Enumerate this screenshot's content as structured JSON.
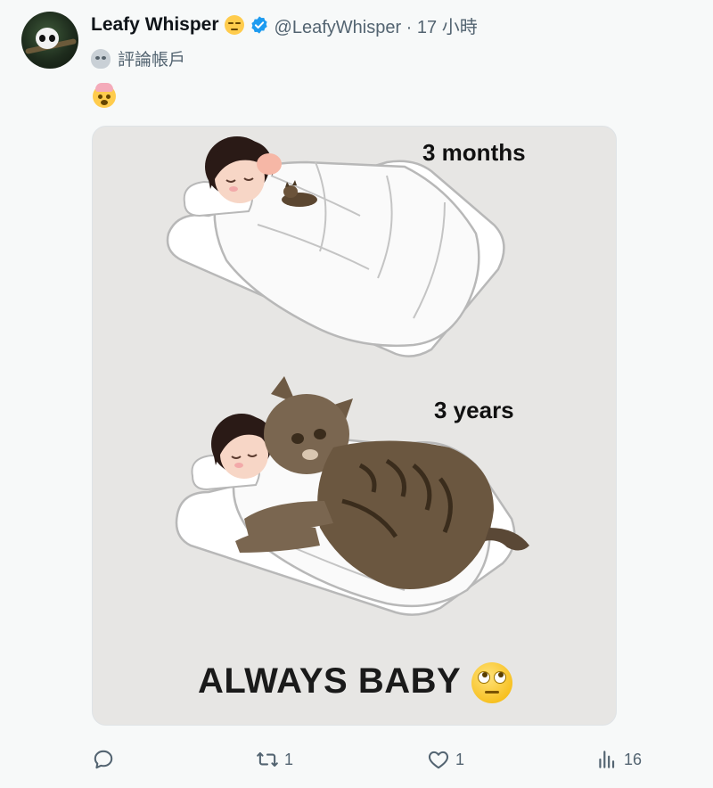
{
  "post": {
    "author_name": "Leafy Whisper",
    "handle_time": "@LeafyWhisper · 17 小時",
    "sub_label": "評論帳戶",
    "name_emoji": "relieved-face-icon",
    "body_emoji": "exploding-head-icon"
  },
  "media": {
    "label_top": "3 months",
    "label_bottom": "3 years",
    "caption": "ALWAYS BABY",
    "caption_emoji": "face-with-rolling-eyes-icon"
  },
  "actions": {
    "replies": "",
    "reposts": "1",
    "likes": "1",
    "views": "16"
  },
  "colors": {
    "background": "#f7f9f9",
    "text": "#0f1419",
    "muted": "#536471",
    "verified": "#1d9bf0",
    "media_bg": "#e7e6e4"
  }
}
